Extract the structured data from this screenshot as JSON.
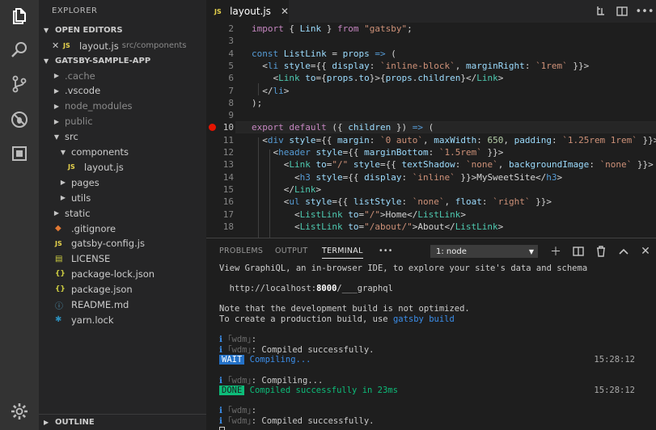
{
  "sidebar": {
    "title": "EXPLORER",
    "open_editors_header": "OPEN EDITORS",
    "open_editor": {
      "name": "layout.js",
      "path": "src/components"
    },
    "project_header": "GATSBY-SAMPLE-APP",
    "outline_header": "OUTLINE",
    "tree": [
      {
        "label": ".cache",
        "kind": "folder",
        "depth": 0,
        "dim": true
      },
      {
        "label": ".vscode",
        "kind": "folder",
        "depth": 0,
        "dim": false
      },
      {
        "label": "node_modules",
        "kind": "folder",
        "depth": 0,
        "dim": true
      },
      {
        "label": "public",
        "kind": "folder",
        "depth": 0,
        "dim": true
      },
      {
        "label": "src",
        "kind": "folder-open",
        "depth": 0,
        "dim": false
      },
      {
        "label": "components",
        "kind": "folder-open",
        "depth": 1,
        "dim": false
      },
      {
        "label": "layout.js",
        "kind": "js",
        "depth": 2,
        "dim": false
      },
      {
        "label": "pages",
        "kind": "folder",
        "depth": 1,
        "dim": false
      },
      {
        "label": "utils",
        "kind": "folder",
        "depth": 1,
        "dim": false
      },
      {
        "label": "static",
        "kind": "folder",
        "depth": 0,
        "dim": false
      },
      {
        "label": ".gitignore",
        "kind": "git",
        "depth": 0,
        "dim": false
      },
      {
        "label": "gatsby-config.js",
        "kind": "js",
        "depth": 0,
        "dim": false
      },
      {
        "label": "LICENSE",
        "kind": "license",
        "depth": 0,
        "dim": false
      },
      {
        "label": "package-lock.json",
        "kind": "json",
        "depth": 0,
        "dim": false
      },
      {
        "label": "package.json",
        "kind": "json",
        "depth": 0,
        "dim": false
      },
      {
        "label": "README.md",
        "kind": "info",
        "depth": 0,
        "dim": false
      },
      {
        "label": "yarn.lock",
        "kind": "yarn",
        "depth": 0,
        "dim": false
      }
    ]
  },
  "tab": {
    "label": "layout.js",
    "badge": "JS"
  },
  "editor": {
    "current_line": 10,
    "breakpoint_line": 10,
    "lines": [
      {
        "n": "2",
        "html": "<span class=\"kc\">import</span> { <span class=\"v\">Link</span> } <span class=\"kc\">from</span> <span class=\"s\">\"gatsby\"</span>;"
      },
      {
        "n": "3",
        "html": ""
      },
      {
        "n": "4",
        "html": "<span class=\"k\">const</span> <span class=\"v\">ListLink</span> = <span class=\"v\">props</span> <span class=\"k\">=&gt;</span> ("
      },
      {
        "n": "5",
        "html": "  &lt;<span class=\"tag\">li</span> <span class=\"attr\">style</span>={{ <span class=\"v\">display</span>: <span class=\"s\">`inline-block`</span>, <span class=\"v\">marginRight</span>: <span class=\"s\">`1rem`</span> }}&gt;"
      },
      {
        "n": "6",
        "html": "    &lt;<span class=\"t\">Link</span> <span class=\"attr\">to</span>={<span class=\"v\">props</span>.<span class=\"v\">to</span>}&gt;{<span class=\"v\">props</span>.<span class=\"v\">children</span>}&lt;/<span class=\"t\">Link</span>&gt;"
      },
      {
        "n": "7",
        "html": "  &lt;/<span class=\"tag\">li</span>&gt;"
      },
      {
        "n": "8",
        "html": ");"
      },
      {
        "n": "9",
        "html": ""
      },
      {
        "n": "10",
        "html": "<span class=\"kc\">export</span> <span class=\"kc\">default</span> ({ <span class=\"v\">children</span> }) <span class=\"k\">=&gt;</span> ("
      },
      {
        "n": "11",
        "html": "  &lt;<span class=\"tag\">div</span> <span class=\"attr\">style</span>={{ <span class=\"v\">margin</span>: <span class=\"s\">`0 auto`</span>, <span class=\"v\">maxWidth</span>: <span class=\"n\">650</span>, <span class=\"v\">padding</span>: <span class=\"s\">`1.25rem 1rem`</span> }}&gt;"
      },
      {
        "n": "12",
        "html": "    &lt;<span class=\"tag\">header</span> <span class=\"attr\">style</span>={{ <span class=\"v\">marginBottom</span>: <span class=\"s\">`1.5rem`</span> }}&gt;"
      },
      {
        "n": "13",
        "html": "      &lt;<span class=\"t\">Link</span> <span class=\"attr\">to</span>=<span class=\"s\">\"/\"</span> <span class=\"attr\">style</span>={{ <span class=\"v\">textShadow</span>: <span class=\"s\">`none`</span>, <span class=\"v\">backgroundImage</span>: <span class=\"s\">`none`</span> }}&gt;"
      },
      {
        "n": "14",
        "html": "        &lt;<span class=\"tag\">h3</span> <span class=\"attr\">style</span>={{ <span class=\"v\">display</span>: <span class=\"s\">`inline`</span> }}&gt;MySweetSite&lt;/<span class=\"tag\">h3</span>&gt;"
      },
      {
        "n": "15",
        "html": "      &lt;/<span class=\"t\">Link</span>&gt;"
      },
      {
        "n": "16",
        "html": "      &lt;<span class=\"tag\">ul</span> <span class=\"attr\">style</span>={{ <span class=\"v\">listStyle</span>: <span class=\"s\">`none`</span>, <span class=\"v\">float</span>: <span class=\"s\">`right`</span> }}&gt;"
      },
      {
        "n": "17",
        "html": "        &lt;<span class=\"t\">ListLink</span> <span class=\"attr\">to</span>=<span class=\"s\">\"/\"</span>&gt;Home&lt;/<span class=\"t\">ListLink</span>&gt;"
      },
      {
        "n": "18",
        "html": "        &lt;<span class=\"t\">ListLink</span> <span class=\"attr\">to</span>=<span class=\"s\">\"/about/\"</span>&gt;About&lt;/<span class=\"t\">ListLink</span>&gt;"
      }
    ]
  },
  "panel": {
    "tabs": [
      "PROBLEMS",
      "OUTPUT",
      "TERMINAL"
    ],
    "more": "•••",
    "terminal_select": "1: node",
    "terminal": [
      {
        "parts": [
          [
            "",
            "View GraphiQL, an in-browser IDE, to explore your site's data and schema"
          ]
        ]
      },
      {
        "parts": []
      },
      {
        "parts": [
          [
            "",
            "  http://localhost:"
          ],
          [
            "bold",
            "8000"
          ],
          [
            "",
            "/___graphql"
          ]
        ]
      },
      {
        "parts": []
      },
      {
        "parts": [
          [
            "",
            "Note that the development build is not optimized."
          ]
        ]
      },
      {
        "parts": [
          [
            "",
            "To create a production build, use "
          ],
          [
            "blue",
            "gatsby build"
          ]
        ]
      },
      {
        "parts": []
      },
      {
        "parts": [
          [
            "blue",
            "ℹ "
          ],
          [
            "dimg",
            "｢wdm｣"
          ],
          [
            "",
            ":"
          ]
        ]
      },
      {
        "parts": [
          [
            "blue",
            "ℹ "
          ],
          [
            "dimg",
            "｢wdm｣"
          ],
          [
            "",
            ": Compiled successfully."
          ]
        ]
      },
      {
        "parts": [
          [
            "wait",
            "WAIT"
          ],
          [
            "blue",
            " Compiling..."
          ]
        ],
        "time": "15:28:12"
      },
      {
        "parts": []
      },
      {
        "parts": [
          [
            "blue",
            "ℹ "
          ],
          [
            "dimg",
            "｢wdm｣"
          ],
          [
            "",
            ": Compiling..."
          ]
        ]
      },
      {
        "parts": [
          [
            "done",
            "DONE"
          ],
          [
            "green",
            " Compiled successfully in 23ms"
          ]
        ],
        "time": "15:28:12"
      },
      {
        "parts": []
      },
      {
        "parts": [
          [
            "blue",
            "ℹ "
          ],
          [
            "dimg",
            "｢wdm｣"
          ],
          [
            "",
            ":"
          ]
        ]
      },
      {
        "parts": [
          [
            "blue",
            "ℹ "
          ],
          [
            "dimg",
            "｢wdm｣"
          ],
          [
            "",
            ": Compiled successfully."
          ]
        ]
      },
      {
        "parts": [
          [
            "cursor",
            ""
          ]
        ]
      }
    ]
  },
  "icons": {
    "activity": [
      "files-icon",
      "search-icon",
      "source-control-icon",
      "debug-icon",
      "extensions-icon",
      "settings-gear-icon"
    ]
  },
  "colors": {
    "breakpoint": "#e51400",
    "wait_badge": "#2472c8",
    "done_badge": "#0dbc79"
  }
}
